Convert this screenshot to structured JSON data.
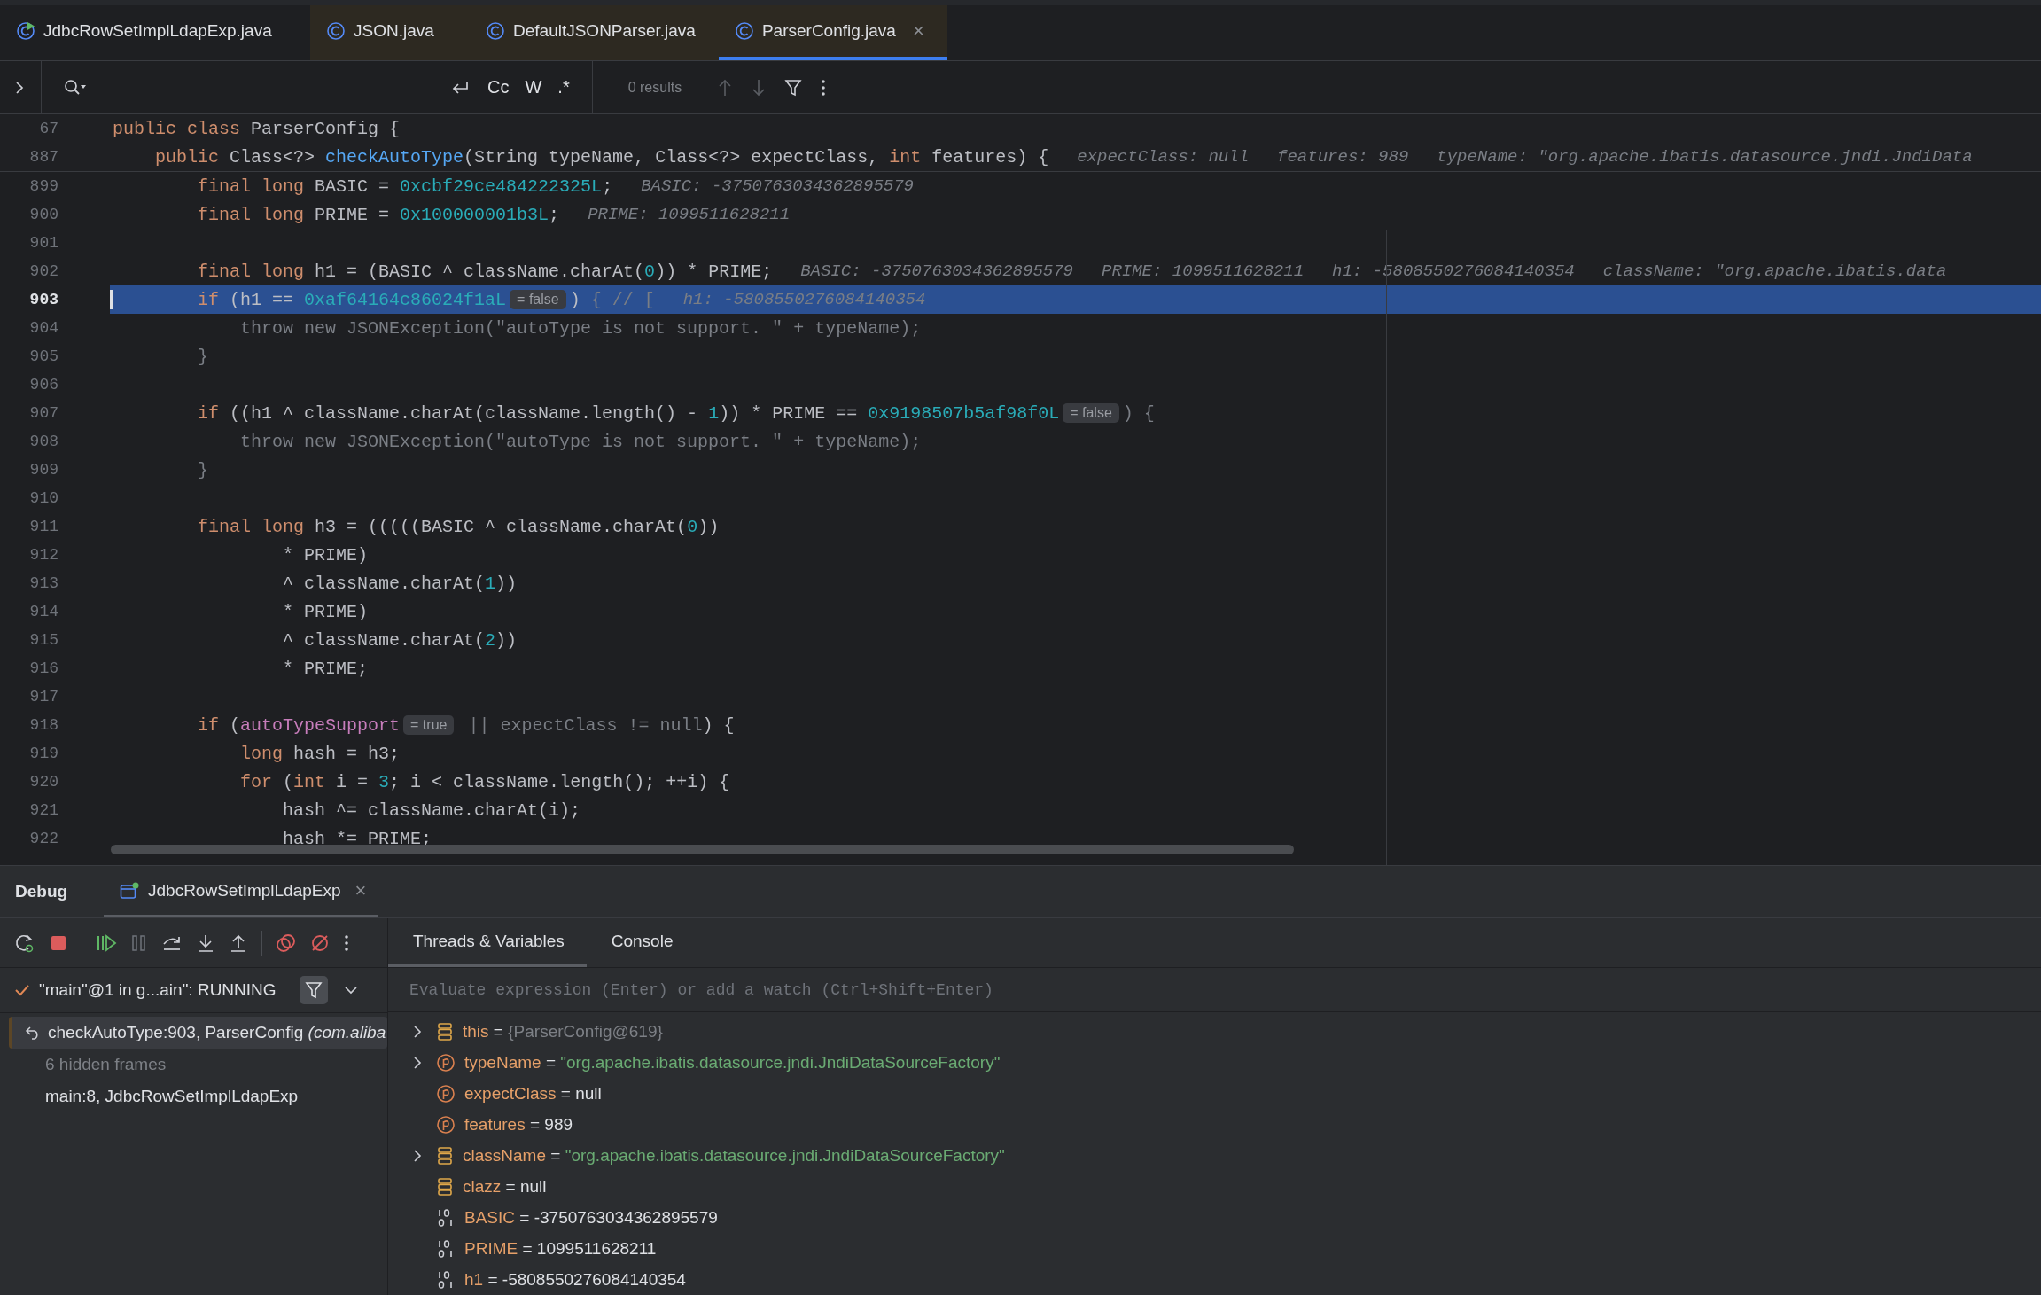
{
  "tabs": [
    {
      "label": "JdbcRowSetImplLdapExp.java",
      "kind": "runnable",
      "library": false,
      "selected": false,
      "closable": false
    },
    {
      "label": "JSON.java",
      "kind": "class",
      "library": true,
      "selected": false,
      "closable": false
    },
    {
      "label": "DefaultJSONParser.java",
      "kind": "class",
      "library": true,
      "selected": false,
      "closable": false
    },
    {
      "label": "ParserConfig.java",
      "kind": "class",
      "library": true,
      "selected": true,
      "closable": true,
      "close": "×"
    }
  ],
  "find_bar": {
    "toggles": [
      "Cc",
      "W",
      ".*"
    ],
    "results": "0 results"
  },
  "sticky_lines": [
    {
      "number": "67",
      "tokens": [
        {
          "kind": "kw",
          "text": "public class"
        },
        {
          "kind": "text",
          "text": " ParserConfig {"
        }
      ]
    },
    {
      "number": "887",
      "tokens": [
        {
          "kind": "kw",
          "text": "    public"
        },
        {
          "kind": "text",
          "text": " Class<?> "
        },
        {
          "kind": "fn",
          "text": "checkAutoType"
        },
        {
          "kind": "text",
          "text": "(String typeName, Class<?> expectClass, "
        },
        {
          "kind": "kw",
          "text": "int"
        },
        {
          "kind": "text",
          "text": " features) {"
        },
        {
          "kind": "hint",
          "text": "expectClass: null"
        },
        {
          "kind": "hint",
          "text": "features: 989"
        },
        {
          "kind": "hint",
          "text": "typeName: \"org.apache.ibatis.datasource.jndi.JndiData"
        }
      ]
    }
  ],
  "code_lines": [
    {
      "number": "899",
      "selected": false,
      "tokens": [
        {
          "kind": "kw",
          "text": "        final long"
        },
        {
          "kind": "text",
          "text": " BASIC = "
        },
        {
          "kind": "num",
          "text": "0xcbf29ce484222325L"
        },
        {
          "kind": "text",
          "text": ";"
        },
        {
          "kind": "hint",
          "text": "BASIC: -3750763034362895579"
        }
      ]
    },
    {
      "number": "900",
      "selected": false,
      "tokens": [
        {
          "kind": "kw",
          "text": "        final long"
        },
        {
          "kind": "text",
          "text": " PRIME = "
        },
        {
          "kind": "num",
          "text": "0x100000001b3L"
        },
        {
          "kind": "text",
          "text": ";"
        },
        {
          "kind": "hint",
          "text": "PRIME: 1099511628211"
        }
      ]
    },
    {
      "number": "901",
      "selected": false
    },
    {
      "number": "902",
      "selected": false,
      "tokens": [
        {
          "kind": "kw",
          "text": "        final long"
        },
        {
          "kind": "text",
          "text": " h1 = (BASIC ^ className.charAt("
        },
        {
          "kind": "num",
          "text": "0"
        },
        {
          "kind": "text",
          "text": ")) * PRIME;"
        },
        {
          "kind": "hint",
          "text": "BASIC: -3750763034362895579"
        },
        {
          "kind": "hint",
          "text": "PRIME: 1099511628211"
        },
        {
          "kind": "hint",
          "text": "h1: -5808550276084140354"
        },
        {
          "kind": "hint",
          "text": "className: \"org.apache.ibatis.data"
        }
      ]
    },
    {
      "number": "903",
      "selected": true,
      "tokens": [
        {
          "kind": "kw",
          "text": "        if"
        },
        {
          "kind": "text",
          "text": " (h1 == "
        },
        {
          "kind": "num",
          "text": "0xaf64164c86024f1aL"
        },
        {
          "kind": "inlay",
          "text": "= false"
        },
        {
          "kind": "text",
          "text": ") "
        },
        {
          "kind": "dim",
          "text": "{ // ["
        },
        {
          "kind": "hint",
          "text": "h1: -5808550276084140354"
        }
      ]
    },
    {
      "number": "904",
      "selected": false,
      "tokens": [
        {
          "kind": "dim",
          "text": "            throw new JSONException(\"autoType is not support. \" + typeName);"
        }
      ]
    },
    {
      "number": "905",
      "selected": false,
      "tokens": [
        {
          "kind": "dim",
          "text": "        }"
        }
      ]
    },
    {
      "number": "906",
      "selected": false
    },
    {
      "number": "907",
      "selected": false,
      "tokens": [
        {
          "kind": "kw",
          "text": "        if"
        },
        {
          "kind": "text",
          "text": " ((h1 ^ className.charAt(className.length() - "
        },
        {
          "kind": "num",
          "text": "1"
        },
        {
          "kind": "text",
          "text": ")) * PRIME == "
        },
        {
          "kind": "num",
          "text": "0x9198507b5af98f0L"
        },
        {
          "kind": "inlay",
          "text": "= false"
        },
        {
          "kind": "dim",
          "text": ") {"
        }
      ]
    },
    {
      "number": "908",
      "selected": false,
      "tokens": [
        {
          "kind": "dim",
          "text": "            throw new JSONException(\"autoType is not support. \" + typeName);"
        }
      ]
    },
    {
      "number": "909",
      "selected": false,
      "tokens": [
        {
          "kind": "dim",
          "text": "        }"
        }
      ]
    },
    {
      "number": "910",
      "selected": false
    },
    {
      "number": "911",
      "selected": false,
      "tokens": [
        {
          "kind": "kw",
          "text": "        final long"
        },
        {
          "kind": "text",
          "text": " h3 = (((((BASIC ^ className.charAt("
        },
        {
          "kind": "num",
          "text": "0"
        },
        {
          "kind": "text",
          "text": "))"
        }
      ]
    },
    {
      "number": "912",
      "selected": false,
      "tokens": [
        {
          "kind": "text",
          "text": "                * PRIME)"
        }
      ]
    },
    {
      "number": "913",
      "selected": false,
      "tokens": [
        {
          "kind": "text",
          "text": "                ^ className.charAt("
        },
        {
          "kind": "num",
          "text": "1"
        },
        {
          "kind": "text",
          "text": "))"
        }
      ]
    },
    {
      "number": "914",
      "selected": false,
      "tokens": [
        {
          "kind": "text",
          "text": "                * PRIME)"
        }
      ]
    },
    {
      "number": "915",
      "selected": false,
      "tokens": [
        {
          "kind": "text",
          "text": "                ^ className.charAt("
        },
        {
          "kind": "num",
          "text": "2"
        },
        {
          "kind": "text",
          "text": "))"
        }
      ]
    },
    {
      "number": "916",
      "selected": false,
      "tokens": [
        {
          "kind": "text",
          "text": "                * PRIME;"
        }
      ]
    },
    {
      "number": "917",
      "selected": false
    },
    {
      "number": "918",
      "selected": false,
      "tokens": [
        {
          "kind": "kw",
          "text": "        if"
        },
        {
          "kind": "text",
          "text": " ("
        },
        {
          "kind": "field",
          "text": "autoTypeSupport"
        },
        {
          "kind": "inlay",
          "text": "= true"
        },
        {
          "kind": "dim",
          "text": " || expectClass != null"
        },
        {
          "kind": "text",
          "text": ") {"
        }
      ]
    },
    {
      "number": "919",
      "selected": false,
      "tokens": [
        {
          "kind": "kw",
          "text": "            long"
        },
        {
          "kind": "text",
          "text": " hash = h3;"
        }
      ]
    },
    {
      "number": "920",
      "selected": false,
      "tokens": [
        {
          "kind": "kw",
          "text": "            for"
        },
        {
          "kind": "text",
          "text": " ("
        },
        {
          "kind": "kw",
          "text": "int"
        },
        {
          "kind": "text",
          "text": " i = "
        },
        {
          "kind": "num",
          "text": "3"
        },
        {
          "kind": "text",
          "text": "; i < className.length(); ++i) {"
        }
      ]
    },
    {
      "number": "921",
      "selected": false,
      "tokens": [
        {
          "kind": "text",
          "text": "                hash ^= className.charAt(i);"
        }
      ]
    },
    {
      "number": "922",
      "selected": false,
      "tokens": [
        {
          "kind": "text",
          "text": "                hash *= PRIME;"
        }
      ]
    }
  ],
  "debug": {
    "title": "Debug",
    "session": {
      "label": "JdbcRowSetImplLdapExp",
      "close": "×"
    },
    "panel_tabs": [
      {
        "label": "Threads & Variables",
        "selected": true
      },
      {
        "label": "Console",
        "selected": false
      }
    ],
    "thread": "\"main\"@1 in g...ain\": RUNNING",
    "frames": [
      {
        "kind": "frame",
        "text": "checkAutoType:903, ParserConfig *(com.aliba*",
        "selected": true
      },
      {
        "kind": "hidden",
        "text": "6 hidden frames",
        "selected": false
      },
      {
        "kind": "frame",
        "text": "main:8, JdbcRowSetImplLdapExp",
        "selected": false
      }
    ],
    "evaluate": {
      "placeholder": "Evaluate expression (Enter) or add a watch (Ctrl+Shift+Enter)"
    },
    "variables": [
      {
        "kind": "object",
        "expandable": true,
        "name": "this",
        "operator": "=",
        "value": "{ParserConfig@619}",
        "color": "#7d8086"
      },
      {
        "kind": "param",
        "expandable": true,
        "name": "typeName",
        "operator": "=",
        "value": "\"org.apache.ibatis.datasource.jndi.JndiDataSourceFactory\"",
        "color": "#6aab73"
      },
      {
        "kind": "param",
        "expandable": false,
        "name": "expectClass",
        "operator": "=",
        "value": "null",
        "color": "#dfe1e5"
      },
      {
        "kind": "param",
        "expandable": false,
        "name": "features",
        "operator": "=",
        "value": "989",
        "color": "#dfe1e5"
      },
      {
        "kind": "object",
        "expandable": true,
        "name": "className",
        "operator": "=",
        "value": "\"org.apache.ibatis.datasource.jndi.JndiDataSourceFactory\"",
        "color": "#6aab73"
      },
      {
        "kind": "object",
        "expandable": false,
        "name": "clazz",
        "operator": "=",
        "value": "null",
        "color": "#dfe1e5"
      },
      {
        "kind": "primitive",
        "expandable": false,
        "name": "BASIC",
        "operator": "=",
        "value": "-3750763034362895579",
        "color": "#dfe1e5"
      },
      {
        "kind": "primitive",
        "expandable": false,
        "name": "PRIME",
        "operator": "=",
        "value": "1099511628211",
        "color": "#dfe1e5"
      },
      {
        "kind": "primitive",
        "expandable": false,
        "name": "h1",
        "operator": "=",
        "value": "-5808550276084140354",
        "color": "#dfe1e5"
      }
    ]
  }
}
